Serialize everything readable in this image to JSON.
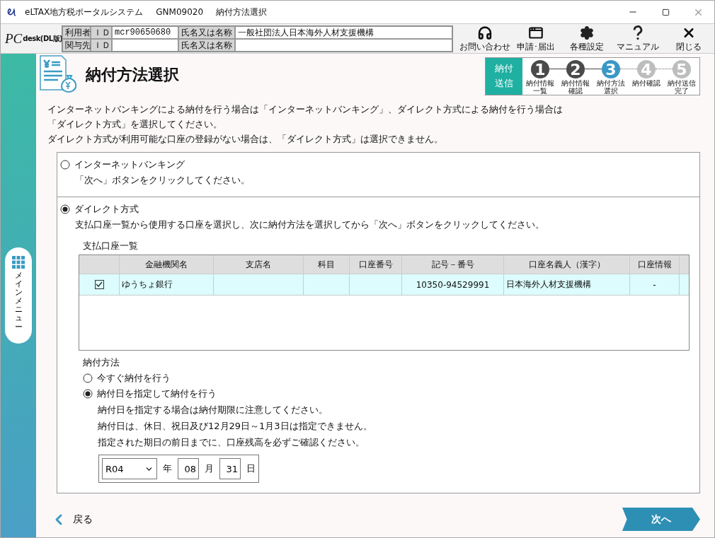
{
  "window": {
    "app": "eLTAX地方税ポータルシステム",
    "code": "GNM09020",
    "title": "納付方法選択"
  },
  "header": {
    "logo": {
      "main": "PC",
      "sub": "desk",
      "edition": "(DL版)"
    },
    "user_rows": [
      {
        "label": "利用者",
        "id_label": "ＩＤ",
        "id": "mcr90650680",
        "name_label": "氏名又は名称",
        "name": "一般社団法人日本海外人材支援機構"
      },
      {
        "label": "関与先",
        "id_label": "ＩＤ",
        "name_label": "氏名又は名称"
      }
    ],
    "toolbar": [
      {
        "kind": "headset",
        "label": "お問い合わせ"
      },
      {
        "kind": "window",
        "label": "申請･届出"
      },
      {
        "kind": "gear",
        "label": "各種設定"
      },
      {
        "kind": "help",
        "label": "マニュアル"
      },
      {
        "kind": "close",
        "label": "閉じる"
      }
    ]
  },
  "sidebar": {
    "menu_label": "メインメニュー"
  },
  "page": {
    "title": "納付方法選択",
    "progress": {
      "badge": "納付送信",
      "steps": [
        {
          "number": "1",
          "label": "納付情報一覧",
          "completed": true,
          "selected": false
        },
        {
          "number": "2",
          "label": "納付情報確認",
          "completed": true,
          "selected": false
        },
        {
          "number": "3",
          "label": "納付方法選択",
          "completed": false,
          "selected": true
        },
        {
          "number": "4",
          "label": "納付確認",
          "completed": false,
          "selected": false
        },
        {
          "number": "5",
          "label": "納付送信完了",
          "completed": false,
          "selected": false
        }
      ]
    },
    "intro": [
      "インターネットバンキングによる納付を行う場合は「インターネットバンキング」、ダイレクト方式による納付を行う場合は",
      "「ダイレクト方式」を選択してください。",
      "ダイレクト方式が利用可能な口座の登録がない場合は、「ダイレクト方式」は選択できません。"
    ],
    "options": [
      {
        "label": "インターネットバンキング",
        "selected": false,
        "description": "「次へ」ボタンをクリックしてください。"
      },
      {
        "label": "ダイレクト方式",
        "selected": true,
        "description": "支払口座一覧から使用する口座を選択し、次に納付方法を選択してから「次へ」ボタンをクリックしてください。",
        "accounts": {
          "title": "支払口座一覧",
          "columns": [
            "金融機関名",
            "支店名",
            "科目",
            "口座番号",
            "記号－番号",
            "口座名義人（漢字）",
            "口座情報"
          ],
          "rows": [
            {
              "checked": true,
              "cells": [
                "ゆうちょ銀行",
                "",
                "",
                "",
                "10350-94529991",
                "日本海外人材支援機構",
                "-"
              ]
            }
          ]
        },
        "payment": {
          "title": "納付方法",
          "choices": [
            {
              "label": "今すぐ納付を行う",
              "selected": false
            },
            {
              "label": "納付日を指定して納付を行う",
              "selected": true
            }
          ],
          "notes": [
            "納付日を指定する場合は納付期限に注意してください。",
            "納付日は、休日、祝日及び12月29日～1月3日は指定できません。",
            "指定された期日の前日までに、口座残高を必ずご確認ください。"
          ],
          "date": {
            "era": "R04",
            "year_label": "年",
            "month": "08",
            "month_label": "月",
            "day": "31",
            "day_label": "日"
          }
        }
      }
    ]
  },
  "footer": {
    "back": "戻る",
    "next": "次へ"
  }
}
